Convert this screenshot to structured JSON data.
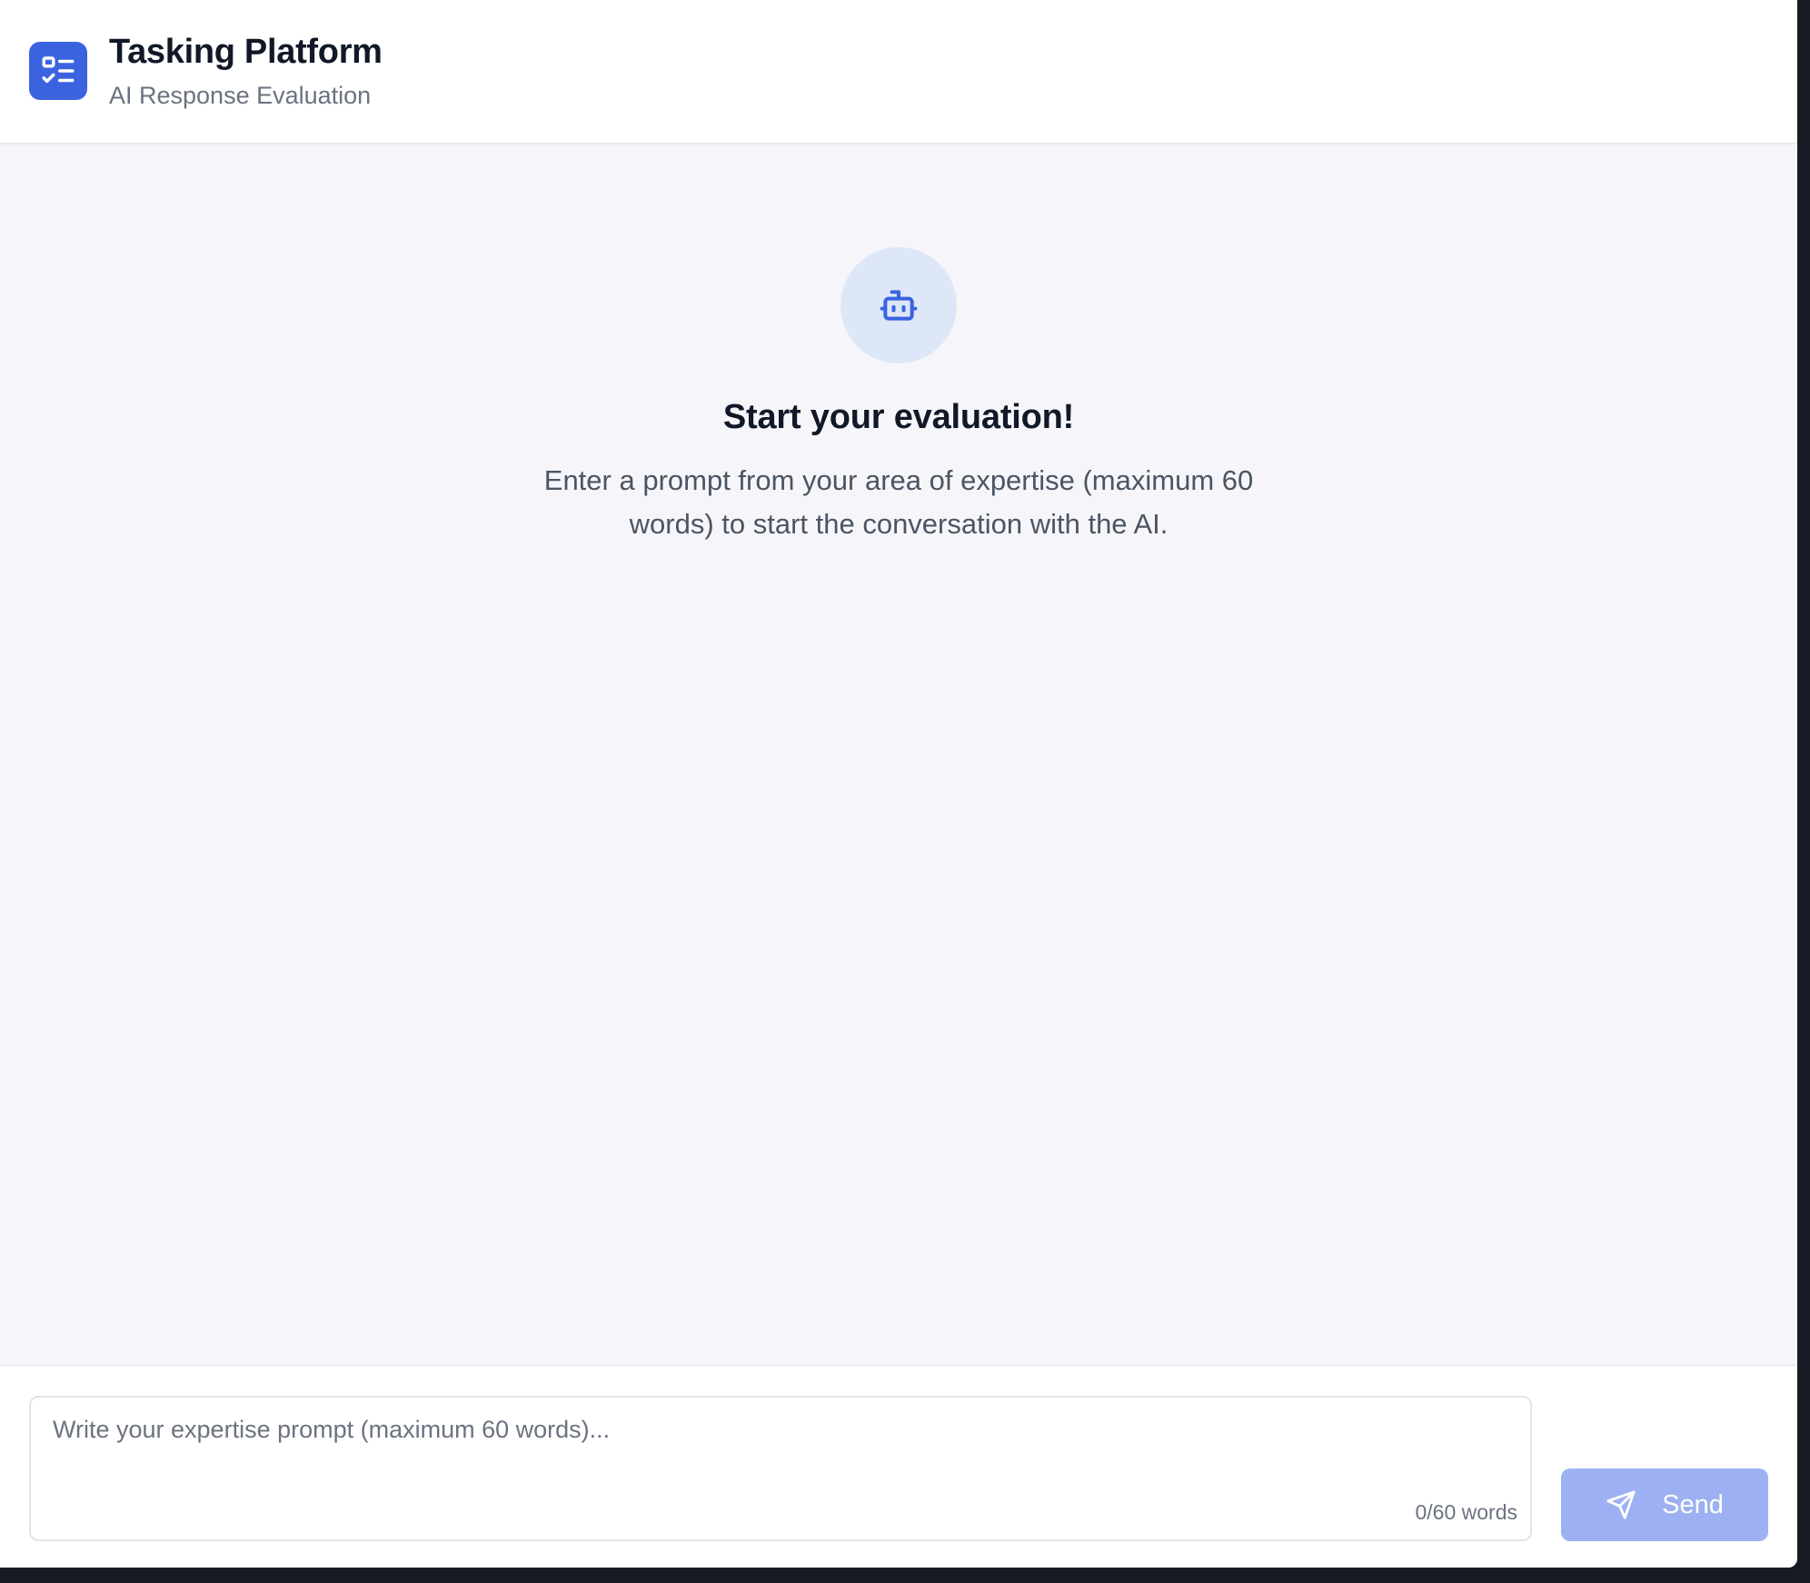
{
  "header": {
    "logo_icon": "task-checklist-icon",
    "title": "Tasking Platform",
    "subtitle": "AI Response Evaluation"
  },
  "empty_state": {
    "icon": "bot-icon",
    "title": "Start your evaluation!",
    "description": "Enter a prompt from your area of expertise (maximum 60 words) to start the conversation with the AI."
  },
  "composer": {
    "placeholder": "Write your expertise prompt (maximum 60 words)...",
    "value": "",
    "word_count": "0/60 words",
    "send_label": "Send",
    "send_icon": "send-icon",
    "send_disabled": true
  },
  "colors": {
    "brand": "#3b63e0",
    "send_disabled_bg": "#9db1f2",
    "avatar_bg": "#dee7f8",
    "page_bg": "#f6f6fa"
  }
}
